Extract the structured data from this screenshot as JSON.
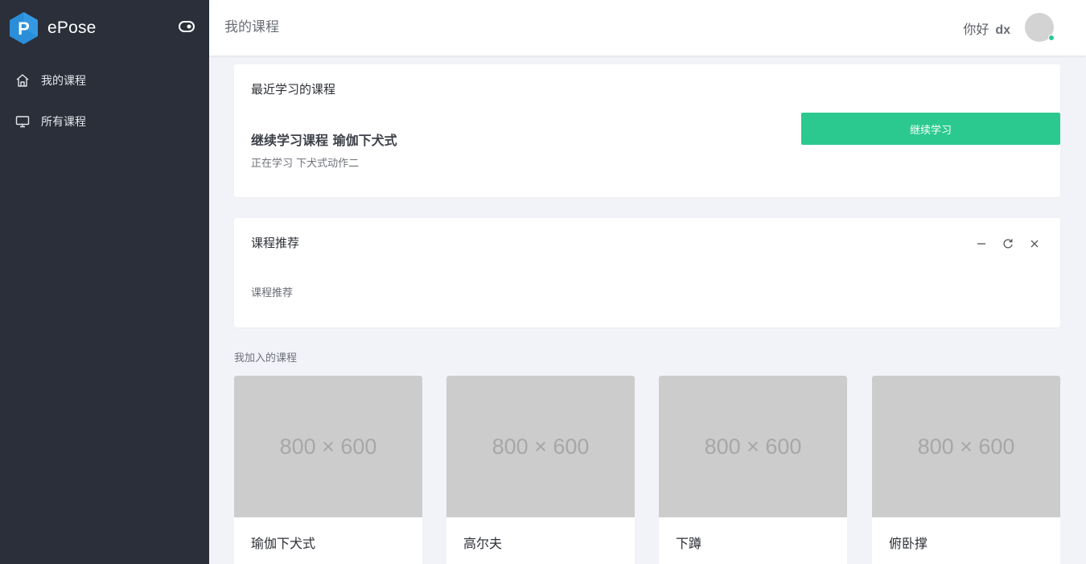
{
  "app": {
    "name": "ePose",
    "brand_color": "#2b8ed8",
    "sidebar_bg": "#2a2f3a",
    "accent": "#2bc990"
  },
  "sidebar": {
    "items": [
      {
        "label": "我的课程",
        "icon": "home-icon"
      },
      {
        "label": "所有课程",
        "icon": "monitor-icon"
      }
    ]
  },
  "header": {
    "title": "我的课程",
    "greeting": "你好",
    "username": "dx"
  },
  "recent": {
    "title": "最近学习的课程",
    "continue_title": "继续学习课程 瑜伽下犬式",
    "continue_sub": "正在学习 下犬式动作二",
    "button_label": "继续学习"
  },
  "recommend": {
    "title": "课程推荐",
    "body": "课程推荐"
  },
  "joined": {
    "label": "我加入的课程",
    "courses": [
      {
        "placeholder": "800 × 600",
        "name": "瑜伽下犬式"
      },
      {
        "placeholder": "800 × 600",
        "name": "高尔夫"
      },
      {
        "placeholder": "800 × 600",
        "name": "下蹲"
      },
      {
        "placeholder": "800 × 600",
        "name": "俯卧撑"
      }
    ]
  }
}
